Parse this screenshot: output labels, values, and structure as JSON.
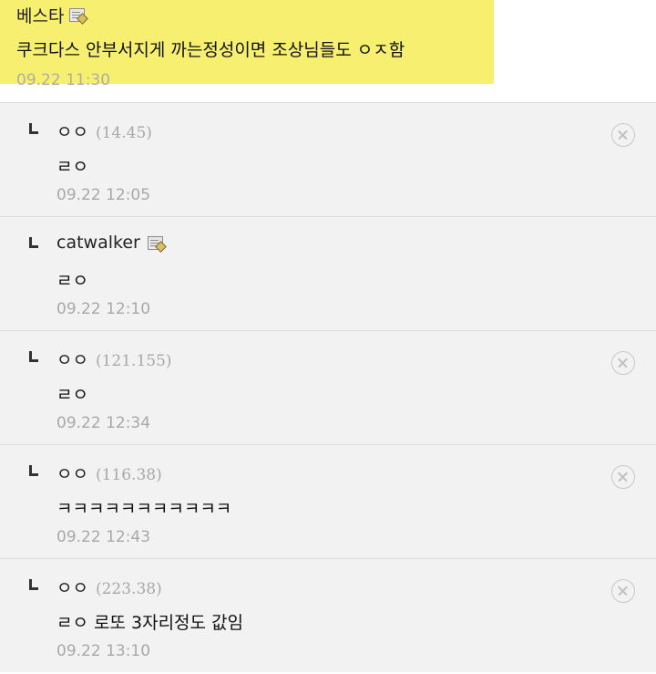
{
  "top_comment": {
    "author": "베스타",
    "author_icon": "memo-icon",
    "body": "쿠크다스 안부서지게 까는정성이면 조상님들도 ㅇㅈ함",
    "time": "09.22 11:30",
    "highlight_color": "#f7ef6f"
  },
  "replies": [
    {
      "name": "ㅇㅇ",
      "ip": "(14.45)",
      "body": "ㄹㅇ",
      "time": "09.22 12:05",
      "has_delete": true
    },
    {
      "name": "catwalker",
      "ip": "",
      "body": "ㄹㅇ",
      "time": "09.22 12:10",
      "has_delete": false,
      "author_icon": "memo-icon"
    },
    {
      "name": "ㅇㅇ",
      "ip": "(121.155)",
      "body": "ㄹㅇ",
      "time": "09.22 12:34",
      "has_delete": true
    },
    {
      "name": "ㅇㅇ",
      "ip": "(116.38)",
      "body": "ㅋㅋㅋㅋㅋㅋㅋㅋㅋㅋㅋ",
      "time": "09.22 12:43",
      "has_delete": true
    },
    {
      "name": "ㅇㅇ",
      "ip": "(223.38)",
      "body": "ㄹㅇ 로또 3자리정도 값임",
      "time": "09.22 13:10",
      "has_delete": true
    }
  ]
}
